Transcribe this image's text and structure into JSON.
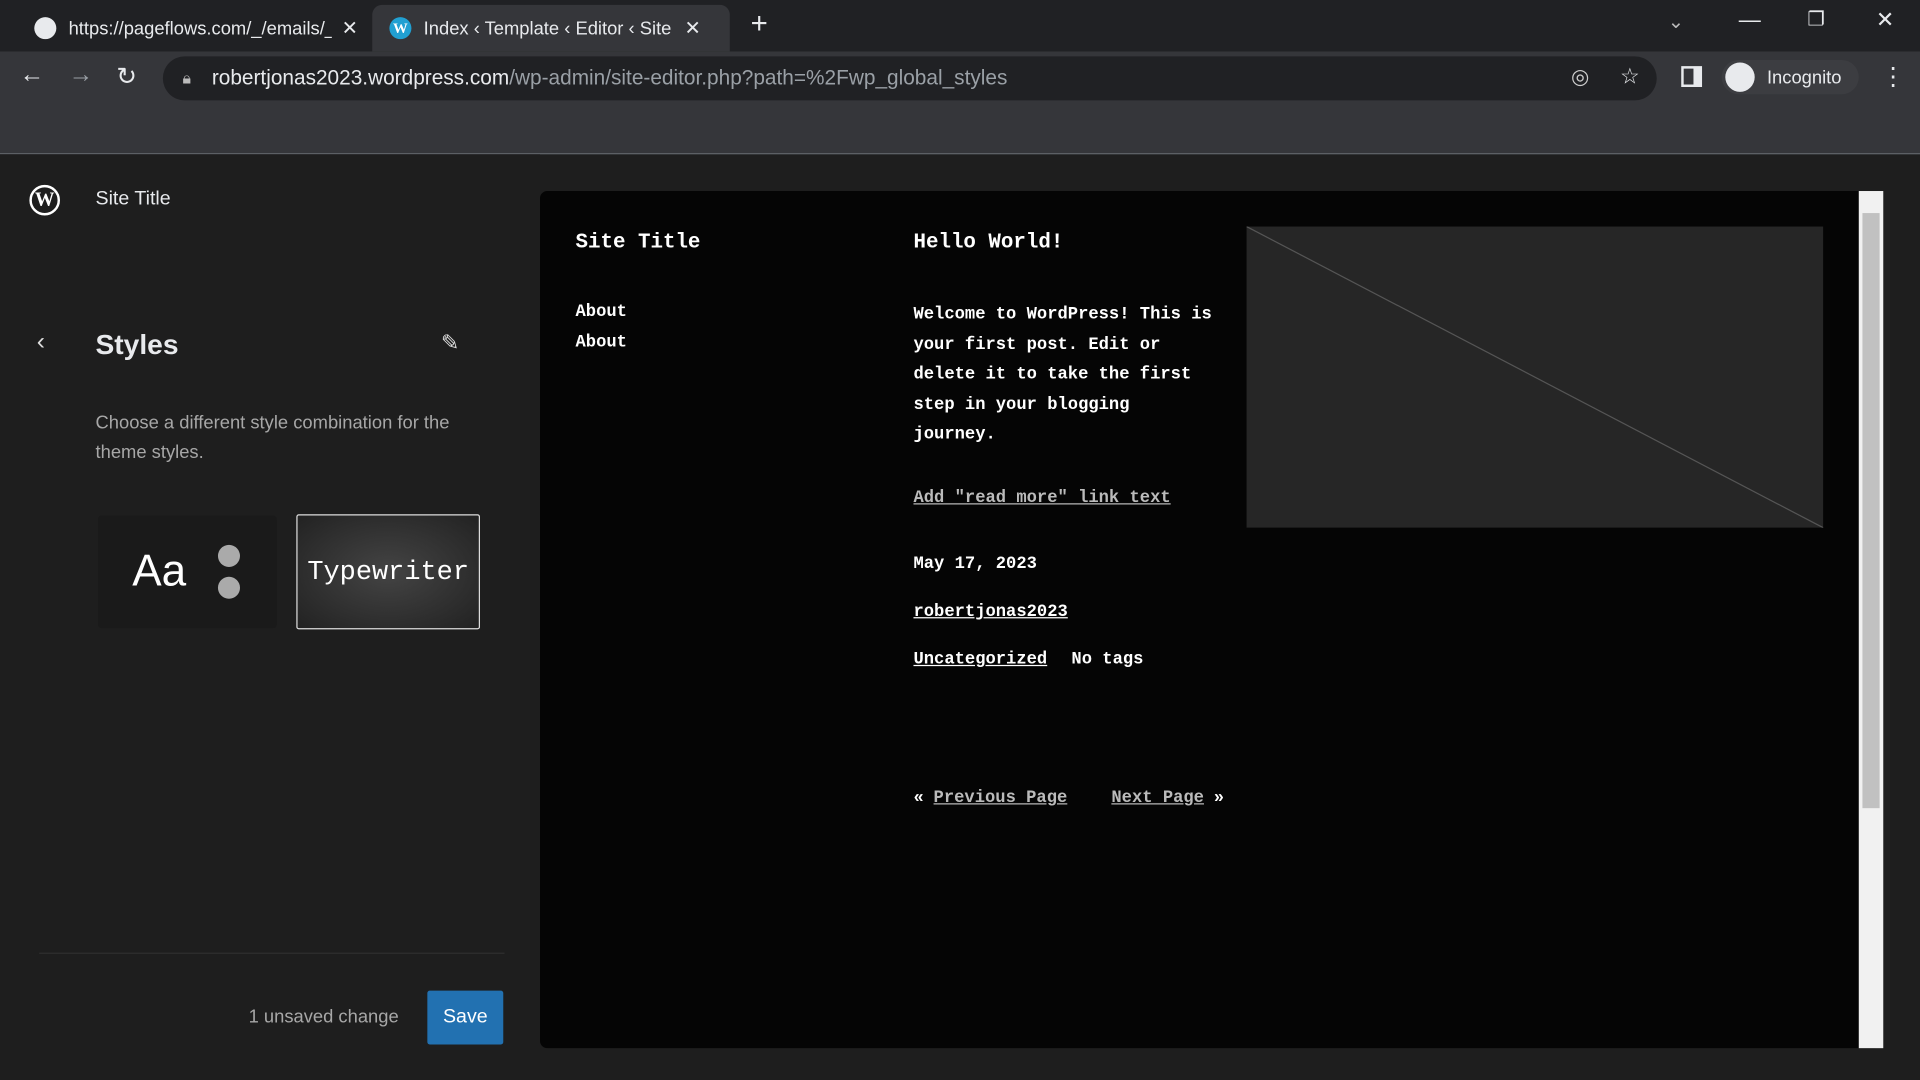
{
  "browser": {
    "tabs": [
      {
        "title": "https://pageflows.com/_/emails/_",
        "icon": "globe-icon"
      },
      {
        "title": "Index ‹ Template ‹ Editor ‹ Site Title",
        "icon": "wordpress-icon"
      }
    ],
    "url_host": "robertjonas2023.wordpress.com",
    "url_path": "/wp-admin/site-editor.php?path=%2Fwp_global_styles",
    "profile": "Incognito"
  },
  "sidebar": {
    "site_title": "Site Title",
    "heading": "Styles",
    "description": "Choose a different style combination for the theme styles.",
    "variations": [
      {
        "label": "Aa"
      },
      {
        "label": "Typewriter",
        "selected": true
      }
    ],
    "unsaved": "1 unsaved change",
    "save": "Save",
    "accent": "#2271b1"
  },
  "preview": {
    "site_title": "Site Title",
    "nav": [
      "About",
      "About"
    ],
    "post_title": "Hello World!",
    "excerpt": "Welcome to WordPress! This is your first post. Edit or delete it to take the first step in your blogging journey.",
    "read_more": "Add \"read more\" link text",
    "date": "May 17, 2023",
    "author": "robertjonas2023",
    "category": "Uncategorized",
    "tags": "No tags",
    "prev_arrow": "«",
    "prev": "Previous Page",
    "next": "Next Page",
    "next_arrow": "»"
  }
}
